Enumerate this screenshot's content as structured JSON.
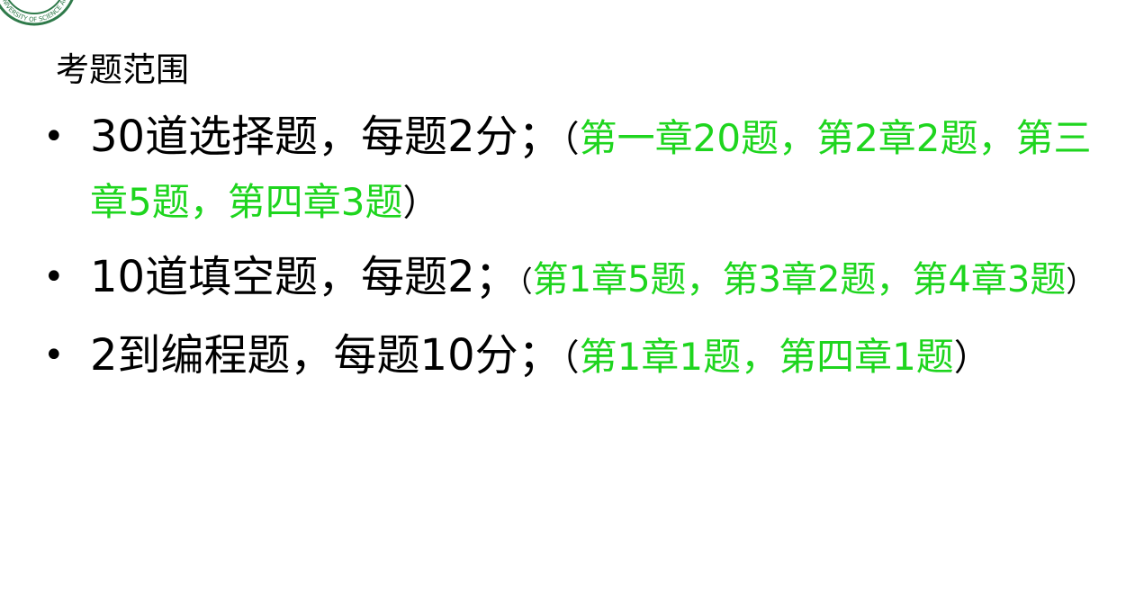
{
  "header": {
    "logo_text": "UNIVERSITY OF SCIENCE AND TECHNOLOGY",
    "subtitle": "考题范围"
  },
  "bullets": [
    {
      "main": "30道选择题，每题2分；",
      "open": "（",
      "note": "第一章20题，第2章2题，第三章5题，第四章3题",
      "close": "）"
    },
    {
      "main": "10道填空题，每题2；",
      "open": "（",
      "note": "第1章5题，第3章2题，第4章3题",
      "close": "）"
    },
    {
      "main": "2到编程题，每题10分；",
      "open": "（",
      "note": "第1章1题，第四章1题",
      "close": "）"
    }
  ],
  "colors": {
    "note_green": "#1ed51e",
    "logo_green": "#2f7a4a"
  }
}
